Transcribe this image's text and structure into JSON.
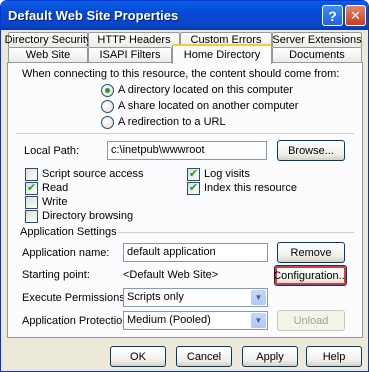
{
  "window": {
    "title": "Default Web Site Properties"
  },
  "tabs_row1": [
    "Directory Security",
    "HTTP Headers",
    "Custom Errors",
    "Server Extensions"
  ],
  "tabs_row2": [
    "Web Site",
    "ISAPI Filters",
    "Home Directory",
    "Documents"
  ],
  "active_tab": "Home Directory",
  "home": {
    "intro": "When connecting to this resource, the content should come from:",
    "options": [
      "A directory located on this computer",
      "A share located on another computer",
      "A redirection to a URL"
    ],
    "selected_option": 0
  },
  "local_path": {
    "label": "Local Path:",
    "value": "c:\\inetpub\\wwwroot",
    "browse": "Browse..."
  },
  "checks_left": [
    {
      "label": "Script source access",
      "checked": false
    },
    {
      "label": "Read",
      "checked": true
    },
    {
      "label": "Write",
      "checked": false
    },
    {
      "label": "Directory browsing",
      "checked": false
    }
  ],
  "checks_right": [
    {
      "label": "Log visits",
      "checked": true
    },
    {
      "label": "Index this resource",
      "checked": true
    }
  ],
  "app_settings": {
    "heading": "Application Settings",
    "name_label": "Application name:",
    "name_value": "default application",
    "remove": "Remove",
    "start_label": "Starting point:",
    "start_value": "<Default Web Site>",
    "config": "Configuration...",
    "exec_label": "Execute Permissions:",
    "exec_value": "Scripts only",
    "prot_label": "Application Protection:",
    "prot_value": "Medium (Pooled)",
    "unload": "Unload"
  },
  "footer": {
    "ok": "OK",
    "cancel": "Cancel",
    "apply": "Apply",
    "help": "Help"
  },
  "colors": {
    "title_bar": "#0449d6",
    "check_green": "#21a121",
    "focus_red": "#d93a35"
  }
}
